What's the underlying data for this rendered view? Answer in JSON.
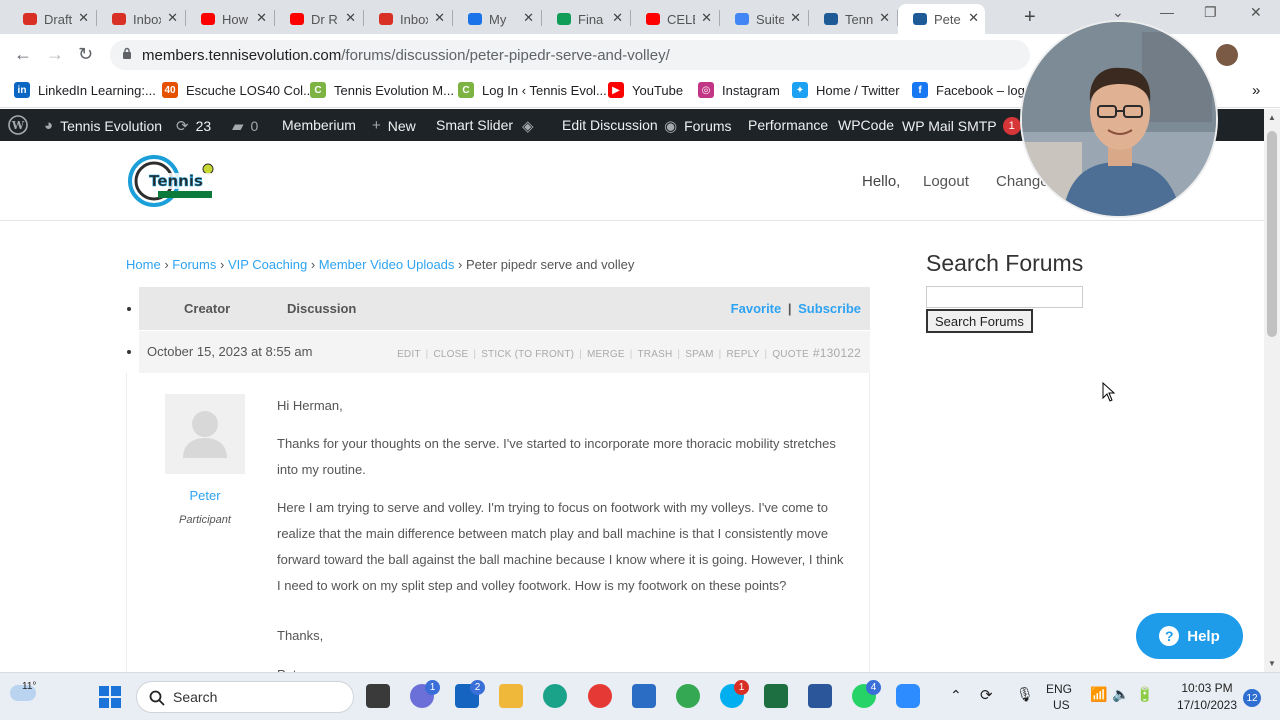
{
  "browser": {
    "tabs": [
      {
        "label": "Draft",
        "icon": "gmail-icon",
        "color": "#d93025"
      },
      {
        "label": "Inbox",
        "icon": "gmail-icon",
        "color": "#d93025"
      },
      {
        "label": "How",
        "icon": "youtube-icon",
        "color": "#ff0000"
      },
      {
        "label": "Dr R",
        "icon": "youtube-icon",
        "color": "#ff0000"
      },
      {
        "label": "Inbox",
        "icon": "gmail-icon",
        "color": "#d93025"
      },
      {
        "label": "My",
        "icon": "drive-icon",
        "color": "#1a73e8"
      },
      {
        "label": "Fina",
        "icon": "sheets-icon",
        "color": "#0f9d58"
      },
      {
        "label": "CELE",
        "icon": "youtube-icon",
        "color": "#ff0000"
      },
      {
        "label": "Suite",
        "icon": "bolt-icon",
        "color": "#4285f4"
      },
      {
        "label": "Tenn",
        "icon": "wordpress-icon",
        "color": "#1e5a96"
      },
      {
        "label": "Pete",
        "icon": "wordpress-icon",
        "color": "#1e5a96"
      }
    ],
    "url_host": "members.tennisevolution.com",
    "url_path": "/forums/discussion/peter-pipedr-serve-and-volley/"
  },
  "bookmarks": [
    {
      "label": "LinkedIn Learning:...",
      "icon": "linkedin-icon",
      "color": "#0a66c2",
      "glyph": "in"
    },
    {
      "label": "Escuche LOS40 Col...",
      "icon": "radio-icon",
      "color": "#e65100",
      "glyph": "40"
    },
    {
      "label": "Tennis Evolution M...",
      "icon": "tennis-icon",
      "color": "#7cb342",
      "glyph": "C"
    },
    {
      "label": "Log In ‹ Tennis Evol...",
      "icon": "tennis-icon",
      "color": "#7cb342",
      "glyph": "C"
    },
    {
      "label": "YouTube",
      "icon": "youtube-icon",
      "color": "#ff0000",
      "glyph": "▶"
    },
    {
      "label": "Instagram",
      "icon": "instagram-icon",
      "color": "#c13584",
      "glyph": "◎"
    },
    {
      "label": "Home / Twitter",
      "icon": "twitter-icon",
      "color": "#1da1f2",
      "glyph": "✦"
    },
    {
      "label": "Facebook – log i",
      "icon": "facebook-icon",
      "color": "#1877f2",
      "glyph": "f"
    }
  ],
  "adminbar": {
    "site": "Tennis Evolution",
    "updates": "23",
    "comments": "0",
    "memberium": "Memberium",
    "new": "New",
    "smart_slider": "Smart Slider",
    "edit_discussion": "Edit Discussion",
    "forums": "Forums",
    "performance": "Performance",
    "wpcode": "WPCode",
    "wp_mail_smtp": "WP Mail SMTP",
    "smtp_badge": "1"
  },
  "header": {
    "nav_hello": "Hello,",
    "nav_logout": "Logout",
    "nav_change": "Change"
  },
  "breadcrumb": {
    "home": "Home",
    "forums": "Forums",
    "vip": "VIP Coaching",
    "uploads": "Member Video Uploads",
    "current": "Peter pipedr serve and volley",
    "sep": "›"
  },
  "forum": {
    "col_creator": "Creator",
    "col_discussion": "Discussion",
    "favorite": "Favorite",
    "subscribe": "Subscribe",
    "divider": "|"
  },
  "post": {
    "date": "October 15, 2023 at 8:55 am",
    "actions": [
      "EDIT",
      "CLOSE",
      "STICK (TO FRONT)",
      "MERGE",
      "TRASH",
      "SPAM",
      "REPLY",
      "QUOTE"
    ],
    "post_id": "#130122",
    "author": "Peter",
    "role": "Participant",
    "greeting": "Hi Herman,",
    "para1": "Thanks for your thoughts on the serve. I've started to incorporate more thoracic mobility stretches into my routine.",
    "para2": "Here I am trying to serve and volley. I'm trying to focus on footwork with my volleys. I've come to realize that the main difference between match play and ball machine is that I consistently move forward toward the ball against the ball machine because I know where it is going. However, I think I need to work on my split step and volley footwork. How is my footwork on these points?",
    "closing": "Thanks,",
    "signature": "Peter"
  },
  "sidebar": {
    "title": "Search Forums",
    "button": "Search Forums"
  },
  "help": {
    "label": "Help"
  },
  "taskbar": {
    "weather": "11°",
    "search": "Search",
    "badges": {
      "teams": "1",
      "mail": "2",
      "skype": "1",
      "whatsapp": "4"
    },
    "lang1": "ENG",
    "lang2": "US",
    "time": "10:03 PM",
    "date": "17/10/2023",
    "notifications": "12"
  }
}
